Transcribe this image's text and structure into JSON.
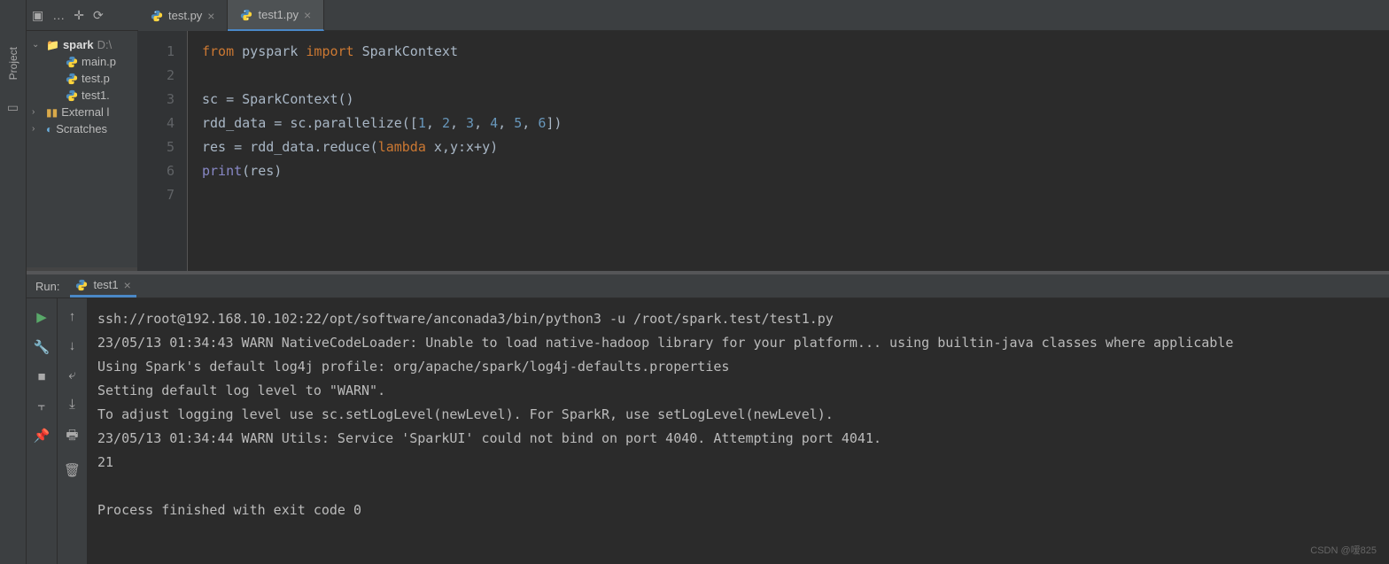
{
  "project_tab_label": "Project",
  "toolbar": {
    "dropdown": "…"
  },
  "tabs": [
    {
      "label": "test.py",
      "active": false
    },
    {
      "label": "test1.py",
      "active": true
    }
  ],
  "tree": {
    "root": {
      "label": "spark",
      "location": "D:\\"
    },
    "files": [
      {
        "label": "main.p"
      },
      {
        "label": "test.p"
      },
      {
        "label": "test1."
      }
    ],
    "external": "External l",
    "scratches": "Scratches"
  },
  "editor": {
    "lines": [
      "1",
      "2",
      "3",
      "4",
      "5",
      "6",
      "7"
    ],
    "code_tokens": [
      [
        {
          "t": "from ",
          "c": "kw"
        },
        {
          "t": "pyspark ",
          "c": ""
        },
        {
          "t": "import ",
          "c": "kw"
        },
        {
          "t": "SparkContext",
          "c": ""
        }
      ],
      [],
      [
        {
          "t": "sc = SparkContext()",
          "c": ""
        }
      ],
      [
        {
          "t": "rdd_data = sc.parallelize([",
          "c": ""
        },
        {
          "t": "1",
          "c": "num"
        },
        {
          "t": ", ",
          "c": ""
        },
        {
          "t": "2",
          "c": "num"
        },
        {
          "t": ", ",
          "c": ""
        },
        {
          "t": "3",
          "c": "num"
        },
        {
          "t": ", ",
          "c": ""
        },
        {
          "t": "4",
          "c": "num"
        },
        {
          "t": ", ",
          "c": ""
        },
        {
          "t": "5",
          "c": "num"
        },
        {
          "t": ", ",
          "c": ""
        },
        {
          "t": "6",
          "c": "num"
        },
        {
          "t": "])",
          "c": ""
        }
      ],
      [
        {
          "t": "res = rdd_data.reduce(",
          "c": ""
        },
        {
          "t": "lambda ",
          "c": "kw"
        },
        {
          "t": "x,y:x+y)",
          "c": ""
        }
      ],
      [
        {
          "t": "print",
          "c": "builtin"
        },
        {
          "t": "(res)",
          "c": ""
        }
      ],
      []
    ]
  },
  "run": {
    "header_label": "Run:",
    "tab_label": "test1",
    "output": "ssh://root@192.168.10.102:22/opt/software/anconada3/bin/python3 -u /root/spark.test/test1.py\n23/05/13 01:34:43 WARN NativeCodeLoader: Unable to load native-hadoop library for your platform... using builtin-java classes where applicable\nUsing Spark's default log4j profile: org/apache/spark/log4j-defaults.properties\nSetting default log level to \"WARN\".\nTo adjust logging level use sc.setLogLevel(newLevel). For SparkR, use setLogLevel(newLevel).\n23/05/13 01:34:44 WARN Utils: Service 'SparkUI' could not bind on port 4040. Attempting port 4041.\n21\n\nProcess finished with exit code 0\n"
  },
  "watermark": "CSDN @嗳825"
}
